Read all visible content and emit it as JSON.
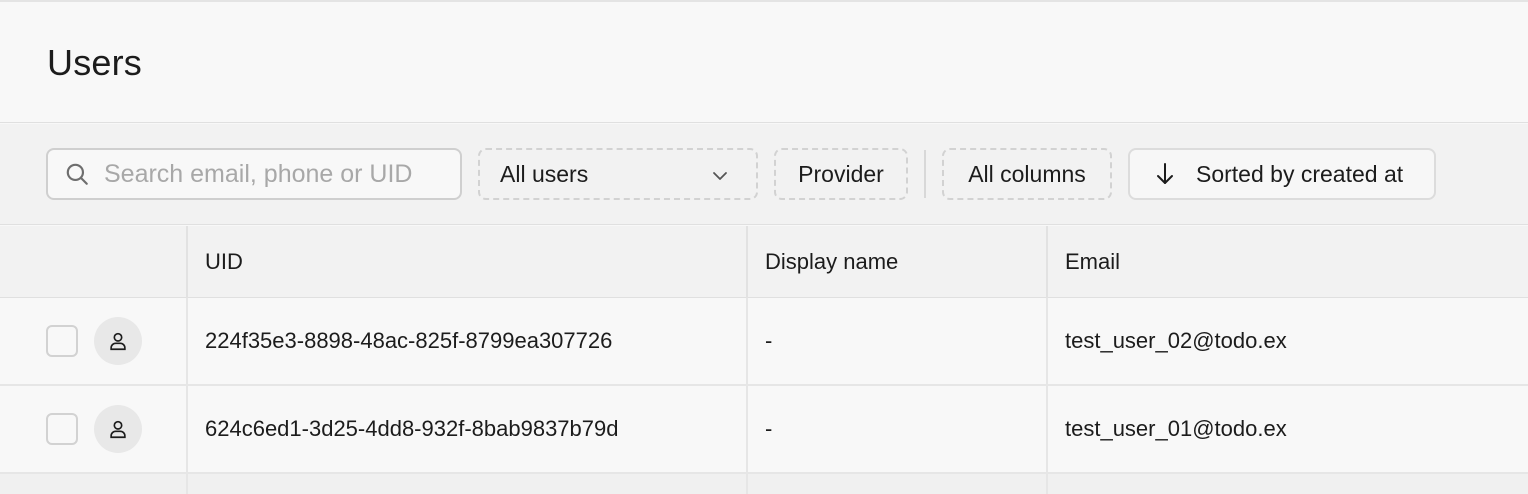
{
  "header": {
    "title": "Users"
  },
  "toolbar": {
    "search_placeholder": "Search email, phone or UID",
    "search_value": "",
    "filter_label": "All users",
    "provider_label": "Provider",
    "columns_label": "All columns",
    "sort_label": "Sorted by created at"
  },
  "table": {
    "columns": [
      "",
      "UID",
      "Display name",
      "Email"
    ],
    "rows": [
      {
        "uid": "224f35e3-8898-48ac-825f-8799ea307726",
        "display_name": "-",
        "email": "test_user_02@todo.ex"
      },
      {
        "uid": "624c6ed1-3d25-4dd8-932f-8bab9837b79d",
        "display_name": "-",
        "email": "test_user_01@todo.ex"
      }
    ]
  },
  "icons": {
    "search": "search-icon",
    "dropdown": "chevron-down-icon",
    "sort": "arrow-down-icon",
    "avatar": "user-icon"
  },
  "colors": {
    "background": "#f8f8f8",
    "toolbar_background": "#f2f2f2",
    "border": "#e0e0e0",
    "text": "#1c1c1c",
    "placeholder": "#a8a8a8"
  }
}
